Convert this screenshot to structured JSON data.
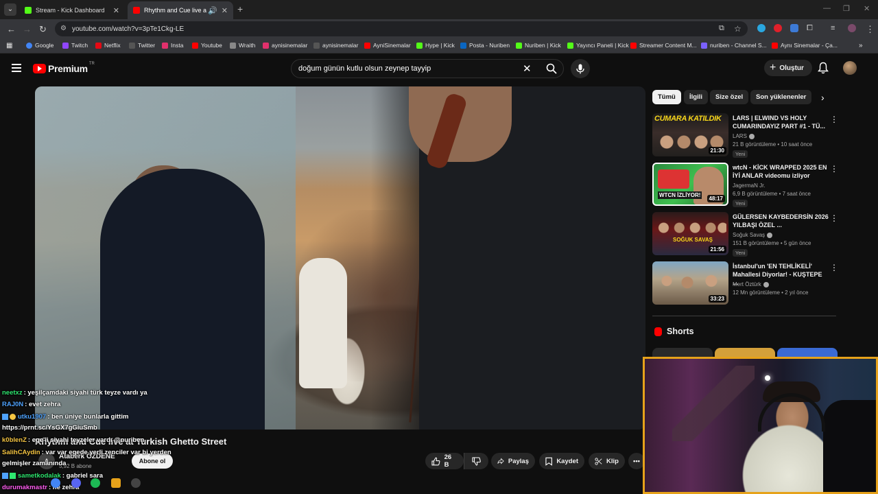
{
  "browser": {
    "tabs": [
      {
        "title": "Stream - Kick Dashboard",
        "active": false,
        "favicon_color": "#53fc18"
      },
      {
        "title": "Rhythm and Cue live at Turk",
        "active": true,
        "favicon_color": "#ff0000"
      }
    ],
    "url": "youtube.com/watch?v=3pTe1Ckg-LE",
    "bookmarks": [
      {
        "label": "Google",
        "color": "#4285f4"
      },
      {
        "label": "Twitch",
        "color": "#9146ff"
      },
      {
        "label": "Netflix",
        "color": "#e50914"
      },
      {
        "label": "Twitter",
        "color": "#111111"
      },
      {
        "label": "Insta",
        "color": "#e1306c"
      },
      {
        "label": "Youtube",
        "color": "#ff0000"
      },
      {
        "label": "Wraith",
        "color": "#888888"
      },
      {
        "label": "aynisinemalar",
        "color": "#e1306c"
      },
      {
        "label": "aynisinemalar",
        "color": "#111111"
      },
      {
        "label": "AyniSinemalar",
        "color": "#ff0000"
      },
      {
        "label": "Hype | Kick",
        "color": "#53fc18"
      },
      {
        "label": "Posta - Nuriben",
        "color": "#0a66c2"
      },
      {
        "label": "Nuriben | Kick",
        "color": "#53fc18"
      },
      {
        "label": "Yayıncı Paneli | Kick",
        "color": "#53fc18"
      },
      {
        "label": "Streamer Content M...",
        "color": "#ff0000"
      },
      {
        "label": "nuriben - Channel S...",
        "color": "#7b61ff"
      },
      {
        "label": "Aynı Sinemalar - Ça...",
        "color": "#ff0000"
      }
    ]
  },
  "header": {
    "logo_text": "Premium",
    "logo_region": "TR",
    "search_value": "doğum günün kutlu olsun zeynep tayyip",
    "create_label": "Oluştur"
  },
  "video": {
    "title": "Rhythm and Cue live at Turkish Ghetto Street",
    "channel": "Atabérk ÖZDENE",
    "channel_initial": "A",
    "subscribers": "5,92 B abone",
    "subscribe_label": "Abone ol",
    "likes": "26 B",
    "share_label": "Paylaş",
    "save_label": "Kaydet",
    "clip_label": "Klip"
  },
  "chips": [
    {
      "label": "Tümü",
      "selected": true
    },
    {
      "label": "İlgili",
      "selected": false
    },
    {
      "label": "Size özel",
      "selected": false
    },
    {
      "label": "Son yüklenenler",
      "selected": false
    }
  ],
  "recommendations": [
    {
      "title": "LARS | ELWIND VS HOLY CUMARINDAYIZ PART #1 - TÜ...",
      "channel": "LARS",
      "verified": true,
      "meta": "21 B görüntüleme • 10 saat önce",
      "badge": "Yeni",
      "duration": "21:30",
      "thumb_text": "CUMARA KATILDIK"
    },
    {
      "title": "wtcN - KİCK WRAPPED 2025 EN İYİ ANLAR videomu izliyor",
      "channel": "JagermaN Jr.",
      "verified": false,
      "meta": "6,9 B görüntüleme • 7 saat önce",
      "badge": "Yeni",
      "duration": "48:17",
      "thumb_text": "WTCN İZLİYOR!"
    },
    {
      "title": "GÜLERSEN KAYBEDERSİN 2026 YILBAŞI ÖZEL ...",
      "channel": "Soğuk Savaş",
      "verified": true,
      "meta": "151 B görüntüleme • 5 gün önce",
      "badge": "Yeni",
      "duration": "21:56",
      "thumb_text": "SOĞUK SAVAŞ"
    },
    {
      "title": "İstanbul'un 'EN TEHLİKELİ' Mahallesi Diyorlar! - KUŞTEPE ...",
      "channel": "Mert Öztürk",
      "verified": true,
      "meta": "12 Mn görüntüleme • 2 yıl önce",
      "badge": "",
      "duration": "33:23",
      "thumb_text": ""
    }
  ],
  "shorts": {
    "label": "Shorts"
  },
  "chat": [
    {
      "user": "neetxz",
      "color": "#2ee66f",
      "message": ": yeşilçamdaki siyahi türk teyze vardı ya"
    },
    {
      "user": "RAJ0N",
      "color": "#4fa3ff",
      "message": ": evet zehra"
    },
    {
      "user": "utku1907",
      "color": "#4fa3ff",
      "message": ": ben üniye bunlarla gittim"
    },
    {
      "user": "",
      "color": "#ffffff",
      "message": "https://prnt.sc/YsGX7gGiuSmb"
    },
    {
      "user": "k0blenZ",
      "color": "#f5c542",
      "message": ": ege'li siyahi teyzeler vardı @nuriben"
    },
    {
      "user": "SalihCAydin",
      "color": "#f5c542",
      "message": ": var var egede yerli zenciler var bi yerden"
    },
    {
      "user": "",
      "color": "#ffffff",
      "message": "gelmişler zamanında"
    },
    {
      "user": "sametkodalak",
      "color": "#2ee66f",
      "message": ": gabriel sara"
    },
    {
      "user": "durumakmastr",
      "color": "#ff5cf0",
      "message": ": ne zehra"
    }
  ],
  "colors": {
    "accent": "#ff0000",
    "webcam_border": "#e6a21a",
    "background": "#0f0f0f"
  }
}
